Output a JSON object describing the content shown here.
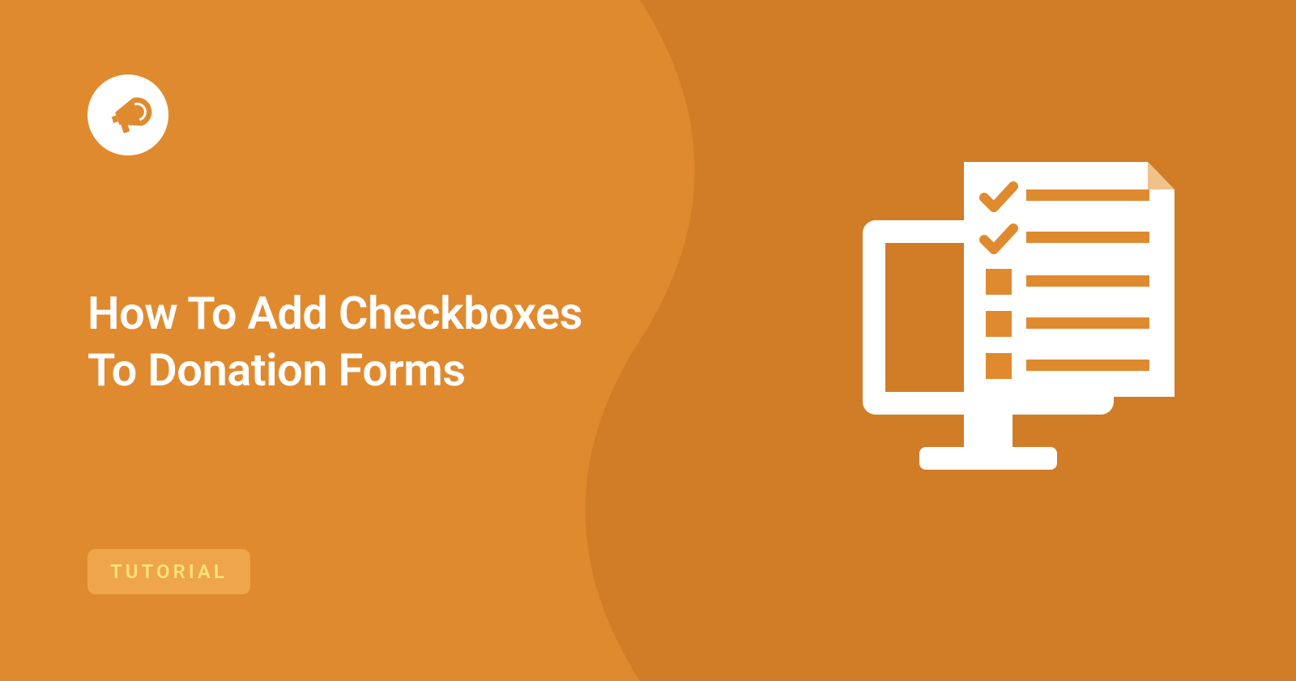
{
  "title_line1": "How To Add Checkboxes",
  "title_line2": "To Donation Forms",
  "badge_label": "TUTORIAL",
  "colors": {
    "bg_left": "#e08a2f",
    "bg_right": "#d17d27",
    "badge_bg": "#efa54a",
    "badge_text": "#ffe27a",
    "icon_accent": "#e08a2f"
  }
}
